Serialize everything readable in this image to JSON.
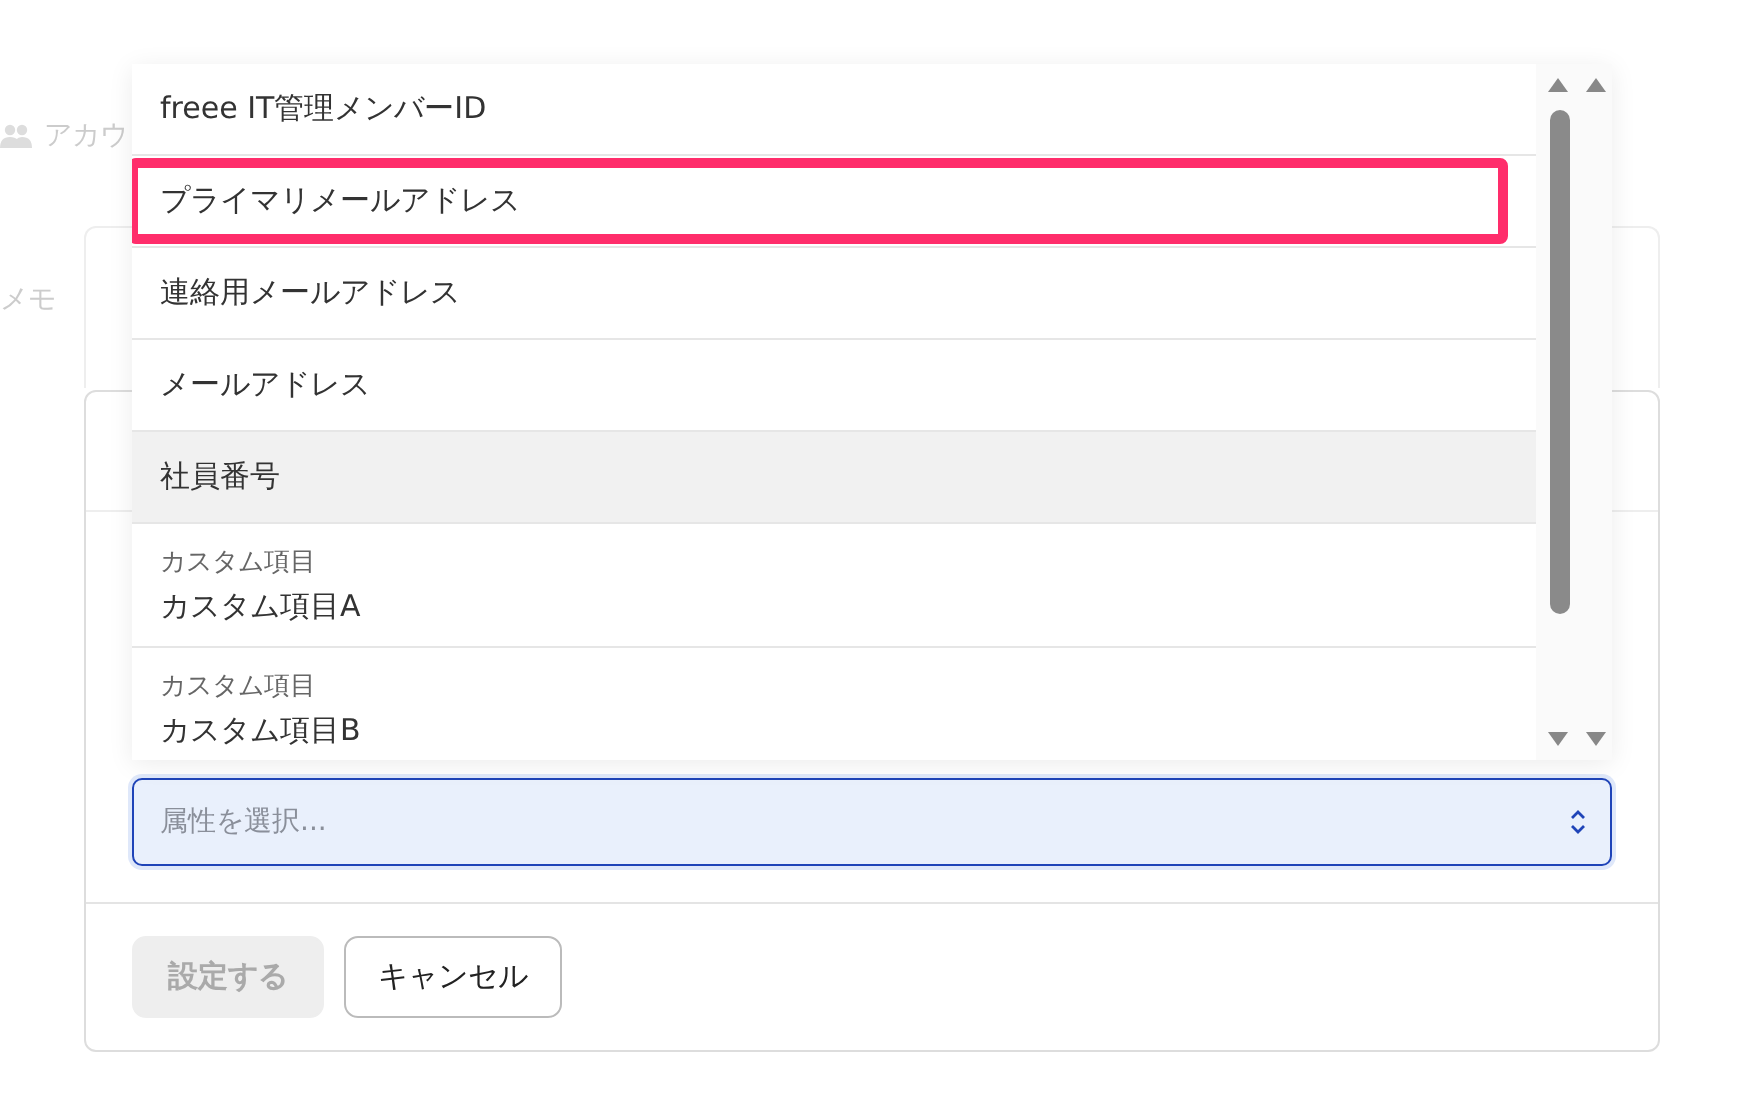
{
  "background": {
    "nav_label": "アカウ",
    "side_label": "メモ"
  },
  "dropdown": {
    "options": [
      {
        "kind": "plain",
        "label": "freee IT管理メンバーID",
        "hovered": false,
        "highlighted": false
      },
      {
        "kind": "plain",
        "label": "プライマリメールアドレス",
        "hovered": false,
        "highlighted": true
      },
      {
        "kind": "plain",
        "label": "連絡用メールアドレス",
        "hovered": false,
        "highlighted": false
      },
      {
        "kind": "plain",
        "label": "メールアドレス",
        "hovered": false,
        "highlighted": false
      },
      {
        "kind": "plain",
        "label": "社員番号",
        "hovered": true,
        "highlighted": false
      },
      {
        "kind": "grouped",
        "group": "カスタム項目",
        "label": "カスタム項目A",
        "hovered": false,
        "highlighted": false
      },
      {
        "kind": "grouped",
        "group": "カスタム項目",
        "label": "カスタム項目B",
        "hovered": false,
        "highlighted": false
      }
    ]
  },
  "select": {
    "placeholder": "属性を選択..."
  },
  "buttons": [
    {
      "label": "設定する",
      "disabled": true
    },
    {
      "label": "キャンセル",
      "disabled": false
    }
  ]
}
